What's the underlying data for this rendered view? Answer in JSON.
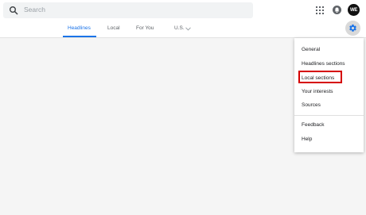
{
  "search": {
    "placeholder": "Search"
  },
  "header": {
    "avatar_initials": "WE"
  },
  "tabs": [
    {
      "label": "Headlines",
      "active": true
    },
    {
      "label": "Local",
      "active": false
    },
    {
      "label": "For You",
      "active": false
    },
    {
      "label": "U.S.",
      "active": false
    }
  ],
  "settings_menu": {
    "items": [
      {
        "label": "General"
      },
      {
        "label": "Headlines sections"
      },
      {
        "label": "Local sections",
        "highlighted": true
      },
      {
        "label": "Your interests"
      },
      {
        "label": "Sources"
      },
      {
        "label": "Feedback"
      },
      {
        "label": "Help"
      }
    ]
  },
  "colors": {
    "accent": "#1a73e8",
    "highlight": "#d50000",
    "background": "#f5f5f5"
  },
  "icons": [
    "search-icon",
    "apps-grid-icon",
    "notifications-icon",
    "gear-icon",
    "chevron-down-icon"
  ]
}
